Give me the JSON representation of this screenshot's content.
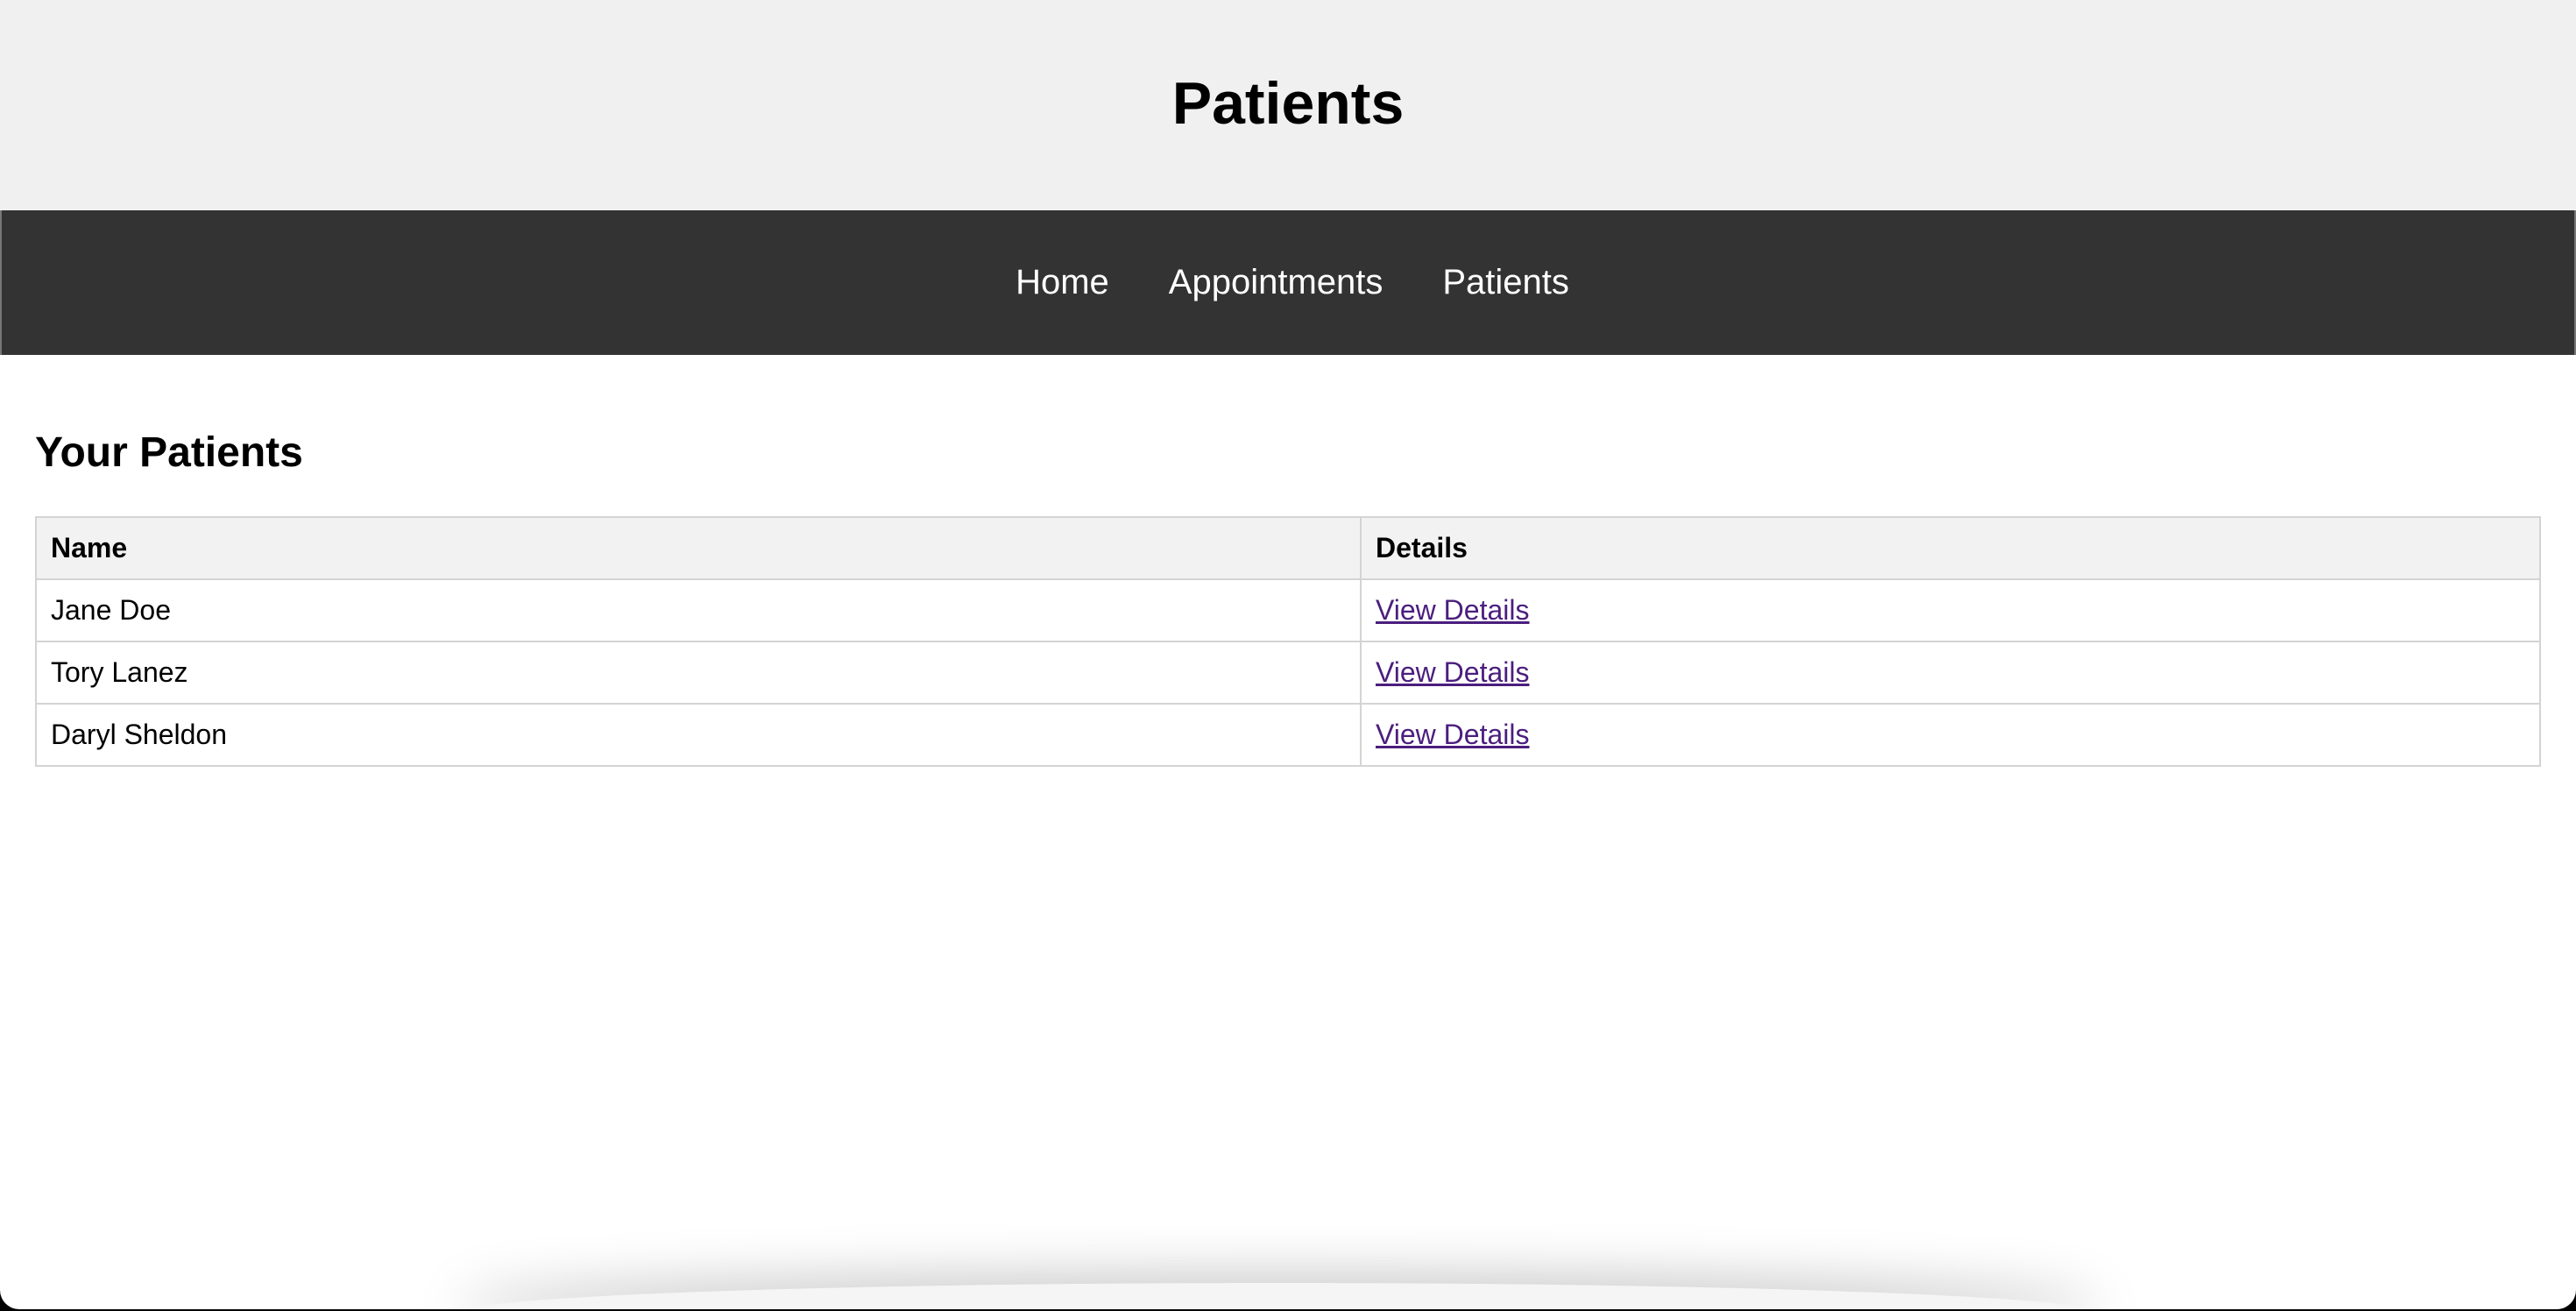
{
  "header": {
    "title": "Patients"
  },
  "nav": {
    "items": [
      {
        "label": "Home"
      },
      {
        "label": "Appointments"
      },
      {
        "label": "Patients"
      }
    ]
  },
  "main": {
    "heading": "Your Patients",
    "table": {
      "columns": [
        "Name",
        "Details"
      ],
      "rows": [
        {
          "name": "Jane Doe",
          "details_link": "View Details"
        },
        {
          "name": "Tory Lanez",
          "details_link": "View Details"
        },
        {
          "name": "Daryl Sheldon",
          "details_link": "View Details"
        }
      ]
    }
  },
  "colors": {
    "header_bg": "#f0f0f0",
    "nav_bg": "#333333",
    "link_visited": "#4b1e7e",
    "table_header_bg": "#f2f2f2",
    "table_border": "#d4d4d4"
  }
}
